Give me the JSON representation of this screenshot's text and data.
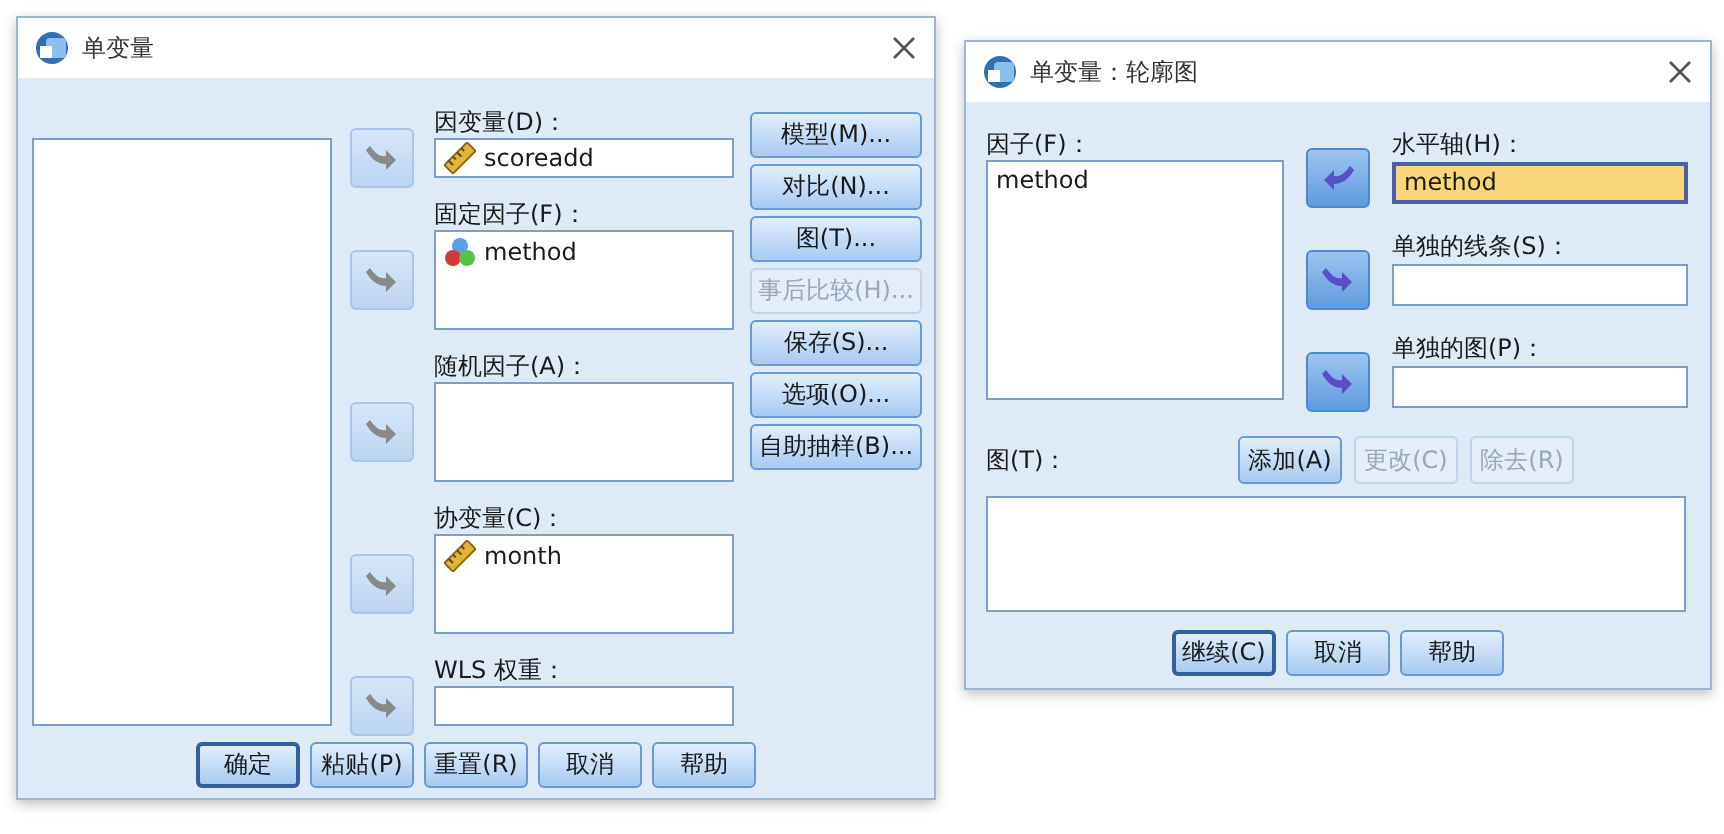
{
  "univariate_dialog": {
    "title": "单变量",
    "targets": [
      {
        "label": "因变量(D)：",
        "kind": "field",
        "arrow_disabled": true,
        "items": [
          {
            "name": "scoreadd",
            "kind": "scale"
          }
        ]
      },
      {
        "label": "固定因子(F)：",
        "kind": "list",
        "arrow_disabled": true,
        "items": [
          {
            "name": "method",
            "kind": "nominal"
          }
        ]
      },
      {
        "label": "随机因子(A)：",
        "kind": "list",
        "arrow_disabled": true
      },
      {
        "label": "协变量(C)：",
        "kind": "list",
        "arrow_disabled": true,
        "items": [
          {
            "name": "month",
            "kind": "scale"
          }
        ]
      },
      {
        "label": "WLS 权重：",
        "kind": "field",
        "arrow_disabled": true
      }
    ],
    "side_buttons": [
      {
        "label": "模型(M)...",
        "disabled": false
      },
      {
        "label": "对比(N)...",
        "disabled": false
      },
      {
        "label": "图(T)...",
        "disabled": false
      },
      {
        "label": "事后比较(H)...",
        "disabled": true
      },
      {
        "label": "保存(S)...",
        "disabled": false
      },
      {
        "label": "选项(O)...",
        "disabled": false
      },
      {
        "label": "自助抽样(B)...",
        "disabled": false
      }
    ],
    "bottom_buttons": [
      {
        "label": "确定",
        "default": true
      },
      {
        "label": "粘贴(P)",
        "default": false
      },
      {
        "label": "重置(R)",
        "default": false
      },
      {
        "label": "取消",
        "default": false
      },
      {
        "label": "帮助",
        "default": false
      }
    ]
  },
  "profile_plots_dialog": {
    "title": "单变量：轮廓图",
    "factors": {
      "label": "因子(F)：",
      "items": [
        "method"
      ]
    },
    "targets": [
      {
        "label": "水平轴(H)：",
        "value": "method",
        "highlighted": true,
        "kind": "remove"
      },
      {
        "label": "单独的线条(S)：",
        "highlighted": false,
        "kind": "add"
      },
      {
        "label": "单独的图(P)：",
        "highlighted": false,
        "kind": "add"
      }
    ],
    "plots": {
      "label": "图(T)：",
      "buttons": [
        {
          "label": "添加(A)",
          "disabled": false
        },
        {
          "label": "更改(C)",
          "disabled": true
        },
        {
          "label": "除去(R)",
          "disabled": true
        }
      ]
    },
    "bottom_buttons": [
      {
        "label": "继续(C)",
        "default": true
      },
      {
        "label": "取消",
        "default": false
      },
      {
        "label": "帮助",
        "default": false
      }
    ]
  }
}
